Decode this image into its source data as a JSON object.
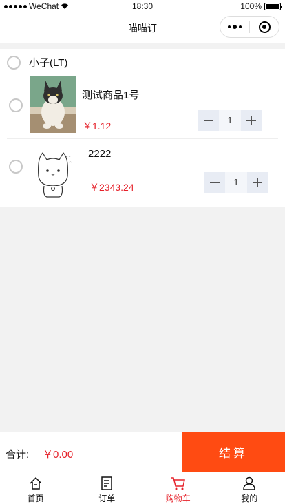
{
  "status_bar": {
    "carrier": "WeChat",
    "time": "18:30",
    "battery": "100%"
  },
  "navbar": {
    "title": "喵喵订"
  },
  "shop": {
    "name": "小子(LT)"
  },
  "items": [
    {
      "name": "测试商品1号",
      "price": "￥1.12",
      "quantity": "1"
    },
    {
      "name": "2222",
      "price": "￥2343.24",
      "quantity": "1"
    }
  ],
  "checkout": {
    "total_label": "合计:",
    "total_value": "￥0.00",
    "pay_label": "结算"
  },
  "tabbar": [
    {
      "label": "首页",
      "icon": "home-icon"
    },
    {
      "label": "订单",
      "icon": "order-icon"
    },
    {
      "label": "购物车",
      "icon": "cart-icon",
      "active": true
    },
    {
      "label": "我的",
      "icon": "user-icon"
    }
  ],
  "colors": {
    "accent": "#ff4b12",
    "price": "#e6212a",
    "stepper_bg": "#e8ecf4"
  }
}
